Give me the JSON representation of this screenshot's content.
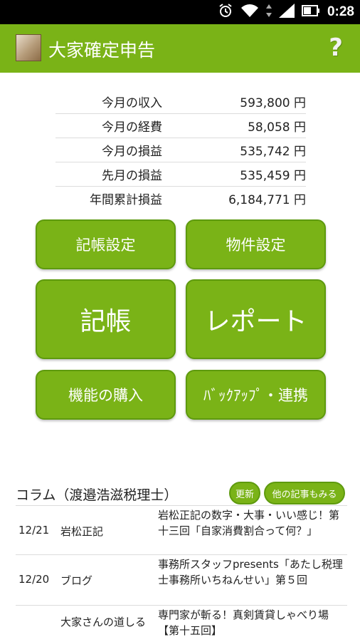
{
  "status_bar": {
    "time": "0:28"
  },
  "app_bar": {
    "title": "大家確定申告",
    "help": "?"
  },
  "summary": [
    {
      "label": "今月の収入",
      "value": "593,800 円"
    },
    {
      "label": "今月の経費",
      "value": "58,058 円"
    },
    {
      "label": "今月の損益",
      "value": "535,742 円"
    },
    {
      "label": "先月の損益",
      "value": "535,459 円"
    },
    {
      "label": "年間累計損益",
      "value": "6,184,771 円"
    }
  ],
  "buttons": {
    "bookkeeping_settings": "記帳設定",
    "property_settings": "物件設定",
    "bookkeeping": "記帳",
    "report": "レポート",
    "purchase": "機能の購入",
    "backup": "ﾊﾞｯｸｱｯﾌﾟ・連携"
  },
  "column": {
    "title": "コラム（渡邉浩滋税理士）",
    "refresh": "更新",
    "more": "他の記事もみる",
    "items": [
      {
        "date": "12/21",
        "category": "岩松正記",
        "text": "岩松正記の数字・大事・いい感じ！第十三回「自家消費割合って何？」"
      },
      {
        "date": "12/20",
        "category": "ブログ",
        "text": "事務所スタッフpresents「あたし税理士事務所いちねんせい」第５回"
      },
      {
        "date": "",
        "category": "大家さんの道しる",
        "text": "専門家が斬る！真剣賃貸しゃべり場【第十五回】"
      }
    ]
  }
}
